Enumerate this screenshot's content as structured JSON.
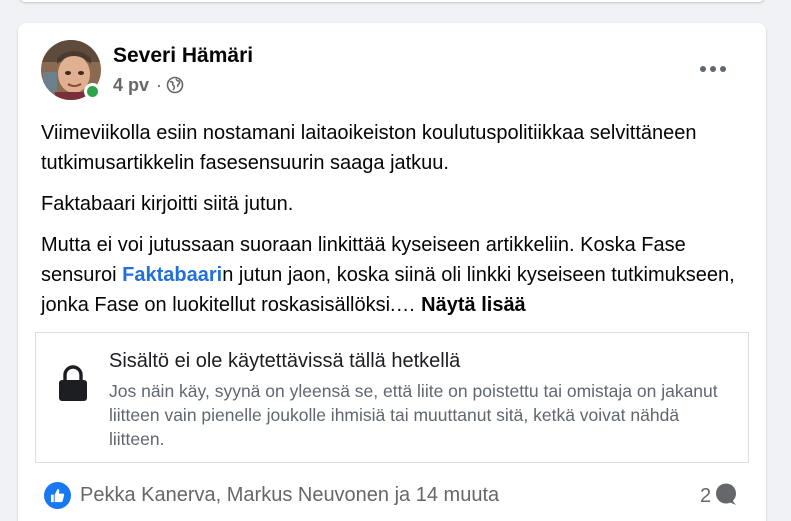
{
  "post": {
    "author": "Severi Hämäri",
    "date": "4 pv",
    "separator": "·",
    "paragraphs": {
      "p1": "Viimeviikolla esiin nostamani laitaoikeiston koulutuspolitiikkaa selvittäneen tutkimusartikkelin fasesensuurin saaga jatkuu.",
      "p2": "Faktabaari kirjoitti siitä jutun.",
      "p3_before": "Mutta ei voi jutussaan suoraan linkittää kyseiseen artikkeliin. Koska Fase sensuroi ",
      "p3_link": "Faktabaari",
      "p3_after": "n jutun jaon, koska siinä oli linkki kyseiseen tutkimukseen, jonka Fase on luokitellut roskasisällöksi.… ",
      "see_more": "Näytä lisää"
    },
    "attachment": {
      "title": "Sisältö ei ole käytettävissä tällä hetkellä",
      "description": "Jos näin käy, syynä on yleensä se, että liite on poistettu tai omistaja on jakanut liitteen vain pienelle joukolle ihmisiä tai muuttanut sitä, ketkä voivat nähdä liitteen."
    },
    "reactions_text": "Pekka Kanerva, Markus Neuvonen ja 14 muuta",
    "comment_count": "2"
  },
  "icons": {
    "privacy": "globe-icon",
    "menu": "more-options-icon",
    "attachment": "lock-icon",
    "reaction": "like-icon",
    "comments": "comment-icon"
  },
  "colors": {
    "link": "#216fdb",
    "online": "#31a24c",
    "like": "#1877f2",
    "secondary_text": "#65676b"
  }
}
